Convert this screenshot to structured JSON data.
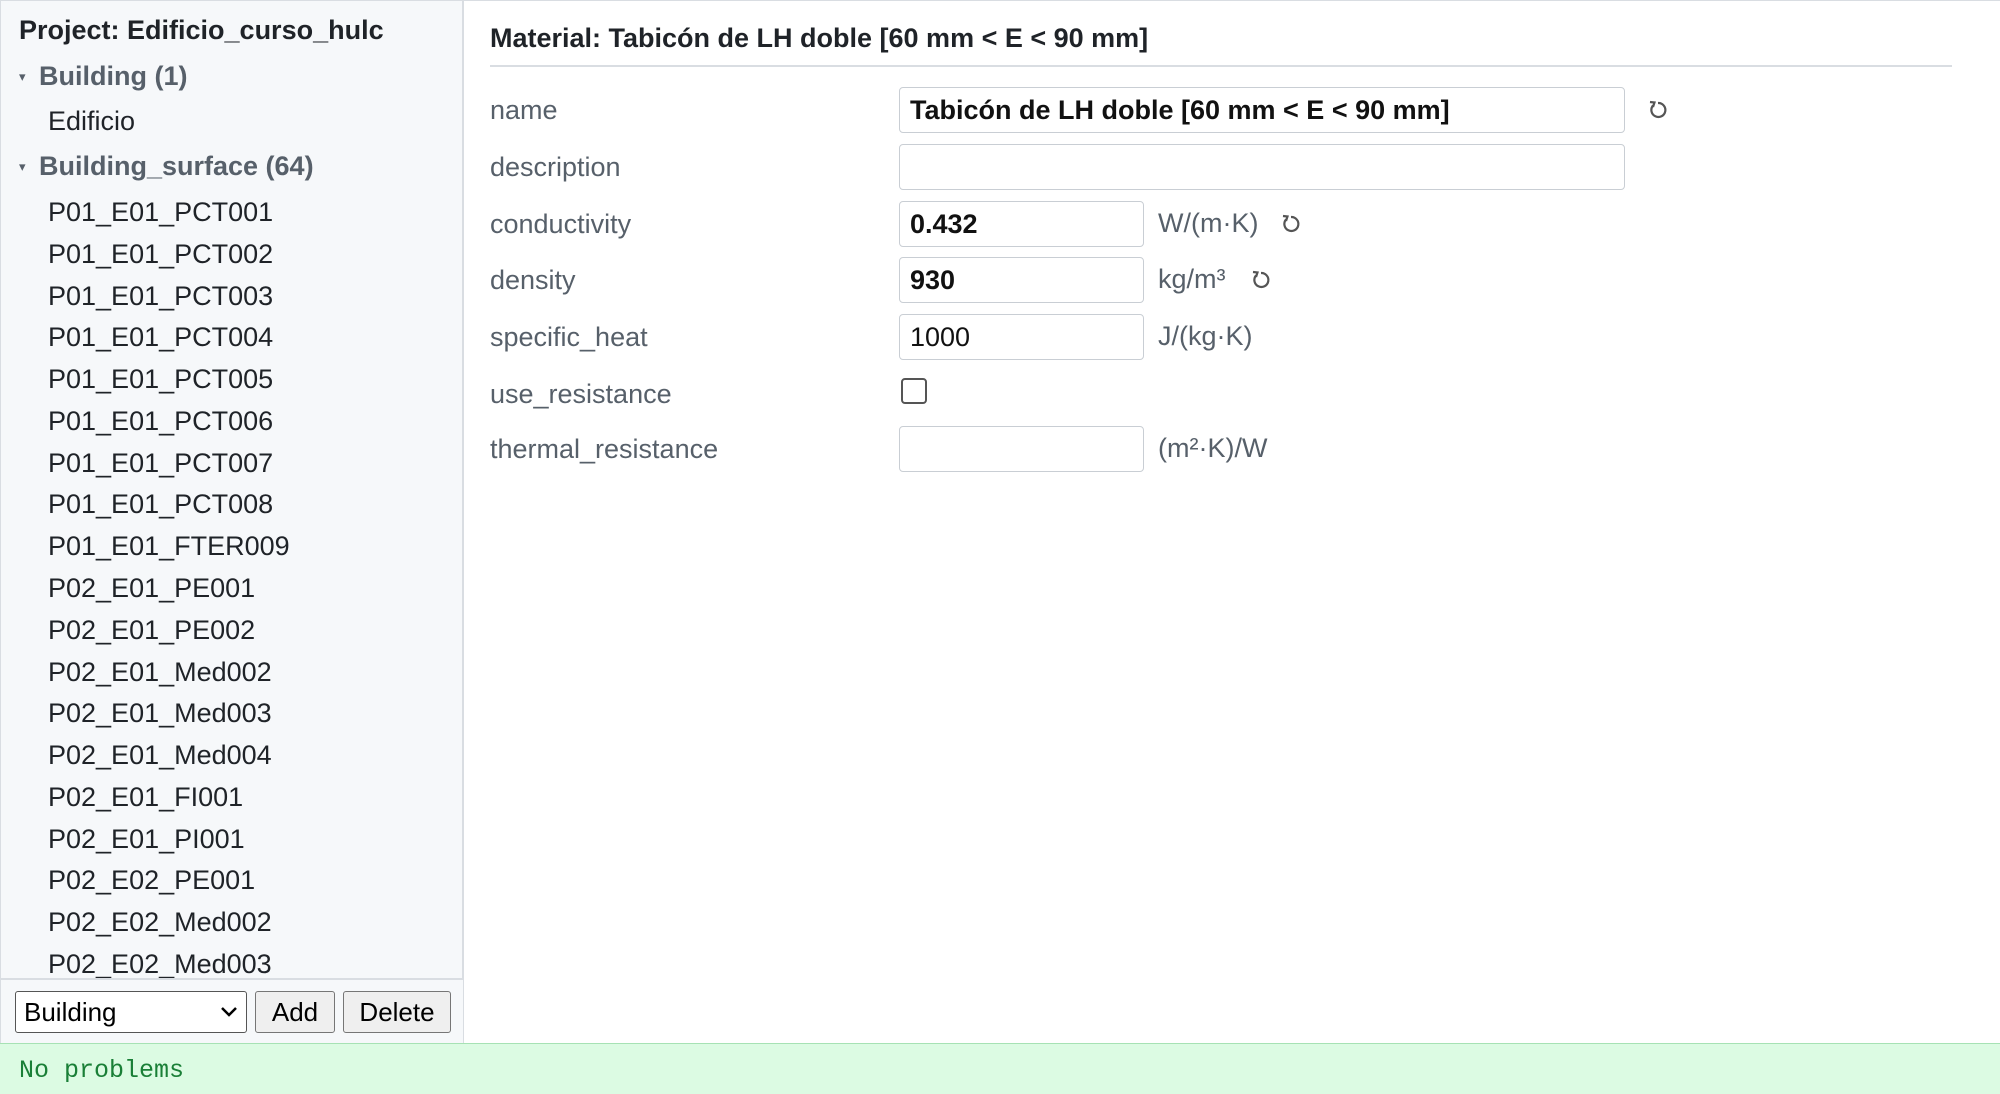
{
  "sidebar": {
    "project_title": "Project: Edificio_curso_hulc",
    "groups": [
      {
        "label": "Building (1)",
        "items": [
          "Edificio"
        ]
      },
      {
        "label": "Building_surface (64)",
        "items": [
          "P01_E01_PCT001",
          "P01_E01_PCT002",
          "P01_E01_PCT003",
          "P01_E01_PCT004",
          "P01_E01_PCT005",
          "P01_E01_PCT006",
          "P01_E01_PCT007",
          "P01_E01_PCT008",
          "P01_E01_FTER009",
          "P02_E01_PE001",
          "P02_E01_PE002",
          "P02_E01_Med002",
          "P02_E01_Med003",
          "P02_E01_Med004",
          "P02_E01_FI001",
          "P02_E01_PI001",
          "P02_E02_PE001",
          "P02_E02_Med002",
          "P02_E02_Med003"
        ]
      }
    ],
    "footer": {
      "type_select_value": "Building",
      "add_label": "Add",
      "delete_label": "Delete"
    }
  },
  "main": {
    "title": "Material: Tabicón de LH doble [60 mm < E < 90 mm]",
    "fields": {
      "name": {
        "label": "name",
        "value": "Tabicón de LH doble [60 mm < E < 90 mm]"
      },
      "description": {
        "label": "description",
        "value": ""
      },
      "conductivity": {
        "label": "conductivity",
        "value": "0.432",
        "unit": "W/(m·K)"
      },
      "density": {
        "label": "density",
        "value": "930",
        "unit": "kg/m³"
      },
      "specific_heat": {
        "label": "specific_heat",
        "value": "1000",
        "unit": "J/(kg·K)"
      },
      "use_resistance": {
        "label": "use_resistance",
        "checked": false
      },
      "thermal_resistance": {
        "label": "thermal_resistance",
        "value": "",
        "unit": "(m²·K)/W"
      }
    }
  },
  "status": {
    "text": "No problems"
  },
  "colors": {
    "status_bg": "#dcfbe3",
    "status_text": "#1a7f37",
    "sidebar_bg": "#f6f8fa"
  },
  "icons": {
    "reset": "reset-icon",
    "caret": "caret-down-icon",
    "select_chevron": "chevron-down-icon"
  }
}
